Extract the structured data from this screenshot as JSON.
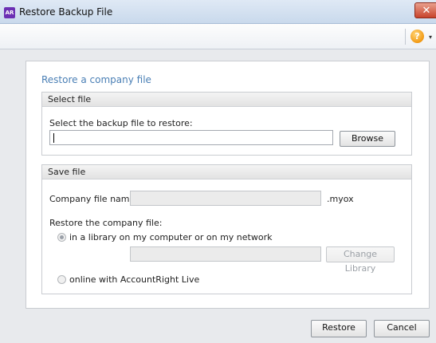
{
  "window": {
    "title": "Restore Backup File",
    "app_icon_text": "AR",
    "close_glyph": "✕"
  },
  "toolbar": {
    "help_glyph": "?",
    "help_dropdown_glyph": "▾"
  },
  "panel": {
    "title": "Restore a company file"
  },
  "select_file": {
    "header": "Select file",
    "prompt": "Select the backup file to restore:",
    "path_value": "",
    "browse_label": "Browse"
  },
  "save_file": {
    "header": "Save file",
    "company_name_label": "Company file name:",
    "company_name_value": "",
    "extension": ".myox",
    "restore_label": "Restore the company file:",
    "option_library_label": "in a library on my computer or on my network",
    "library_path_value": "",
    "change_library_label": "Change Library",
    "option_online_label": "online with AccountRight Live",
    "selected_option": "library"
  },
  "footer": {
    "restore_label": "Restore",
    "cancel_label": "Cancel"
  }
}
